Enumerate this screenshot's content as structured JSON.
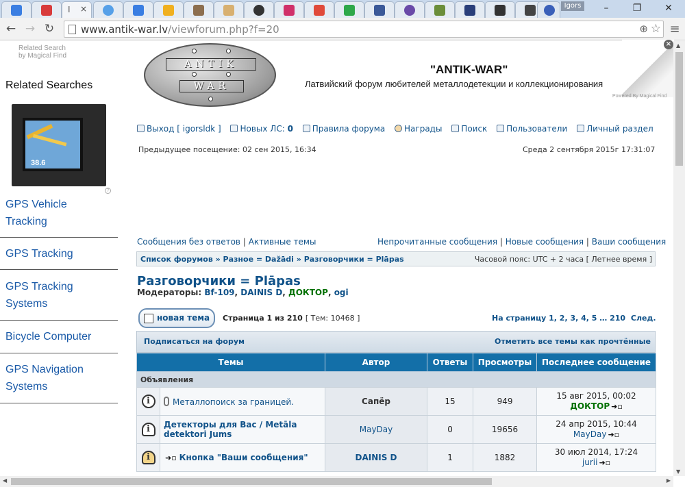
{
  "browser": {
    "active_tab_text": "I",
    "tab_close": "×",
    "profile_name": "Igors",
    "url_host": "www.antik-war.lv",
    "url_path": "/viewforum.php?f=20",
    "tab_icons": [
      "mail-icon",
      "mail-icon",
      "bookmark-icon",
      "bird-icon",
      "drive-icon",
      "image-icon",
      "bookmark-icon",
      "spider-icon",
      "letter-r-icon",
      "google-plus-icon",
      "letter-ss-icon",
      "facebook-icon",
      "circle-icon",
      "image-icon",
      "letter-z-icon",
      "dog-icon",
      "suitcase-icon",
      "diamond-icon"
    ],
    "tab_colors": [
      "#3a7ee2",
      "#d83b3b",
      "#ffffff",
      "#3a7ee2",
      "#56a0e8",
      "#f0b020",
      "#8c6e4e",
      "#d8b070",
      "#333333",
      "#d0306a",
      "#e04a3a",
      "#2ea84a",
      "#3b5998",
      "#6a4aa8",
      "#6b8e3a",
      "#2a3f7a",
      "#333333",
      "#444444",
      "#3a5fb8"
    ]
  },
  "sidebar": {
    "ad_label_1": "Related Search",
    "ad_label_2": "by Magical Find",
    "heading": "Related Searches",
    "image_speed": "38.6",
    "links": [
      {
        "line1": "GPS Vehicle",
        "line2": "Tracking"
      },
      {
        "line1": "GPS Tracking",
        "line2": ""
      },
      {
        "line1": "GPS Tracking",
        "line2": "Systems"
      },
      {
        "line1": "Bicycle Computer",
        "line2": ""
      },
      {
        "line1": "GPS Navigation",
        "line2": "Systems"
      }
    ]
  },
  "header": {
    "logo_line1": "ANTIK",
    "logo_line2": "WAR",
    "site_title": "\"ANTIK-WAR\"",
    "site_description": "Латвийский форум любителей металлодетекции и коллекционирования",
    "peel_credit": "Powered By Magical Find",
    "close_ad": "×"
  },
  "topnav": {
    "logout": "Выход [ igorsldk ]",
    "new_pm_label": "Новых ЛС:",
    "new_pm_count": "0",
    "rules": "Правила форума",
    "awards": "Награды",
    "search": "Поиск",
    "members": "Пользователи",
    "ucp": "Личный раздел"
  },
  "visit": {
    "last_visit": "Предыдущее посещение: 02 сен 2015, 16:34",
    "current_date": "Среда 2 сентября 2015г 17:31:07"
  },
  "quick_links": {
    "unanswered": "Сообщения без ответов",
    "active": "Активные темы",
    "unread": "Непрочитанные сообщения",
    "new_posts": "Новые сообщения",
    "your_posts": "Ваши сообщения",
    "sep": "|"
  },
  "breadcrumb": {
    "path": "Список форумов » Разное = Dažādi » Разговорчики = Plāpas",
    "timezone": "Часовой пояс: UTC + 2 часа [ Летнее время ]"
  },
  "forum": {
    "title": "Разговорчики = Plāpas",
    "moderators_label": "Модераторы:",
    "moderators": [
      "Bf-109",
      "DAINIS D",
      "ДОКТОР",
      "ogi"
    ],
    "mod_sep": ", ",
    "new_topic": "новая тема",
    "page_info": "Страница 1 из 210",
    "topic_count": "[ Тем: 10468 ]",
    "goto_label": "На страницу",
    "pages": "1, 2, 3, 4, 5 … 210",
    "next": "След.",
    "subscribe": "Подписаться на форум",
    "mark_read": "Отметить все темы как прочтённые"
  },
  "table": {
    "headers": [
      "Темы",
      "Автор",
      "Ответы",
      "Просмотры",
      "Последнее сообщение"
    ],
    "section": "Объявления",
    "rows": [
      {
        "title": "Металлопоиск за границей.",
        "author": "Сапёр",
        "replies": "15",
        "views": "949",
        "last_date": "15 авг 2015, 00:02",
        "last_user": "ДОКТОР"
      },
      {
        "title": "Детекторы для Вас / Metāla detektori Jums",
        "author": "MayDay",
        "replies": "0",
        "views": "19656",
        "last_date": "24 апр 2015, 10:44",
        "last_user": "MayDay"
      },
      {
        "title": "Кнопка \"Ваши сообщения\"",
        "author": "DAINIS D",
        "replies": "1",
        "views": "1882",
        "last_date": "30 июл 2014, 17:24",
        "last_user": "jurii"
      }
    ]
  }
}
